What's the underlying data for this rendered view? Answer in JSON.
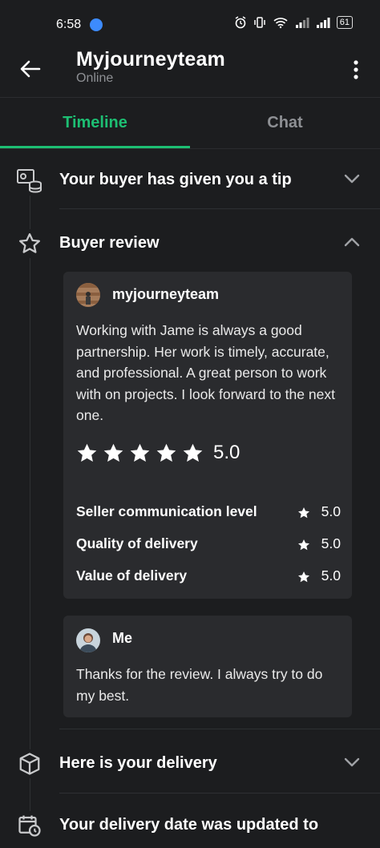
{
  "status": {
    "time": "6:58",
    "battery": "61"
  },
  "header": {
    "title": "Myjourneyteam",
    "subtitle": "Online"
  },
  "tabs": [
    {
      "label": "Timeline",
      "active": true
    },
    {
      "label": "Chat",
      "active": false
    }
  ],
  "timeline": {
    "tip": {
      "title": "Your buyer has given you a tip"
    },
    "review": {
      "title": "Buyer review",
      "reviewer": {
        "name": "myjourneyteam",
        "text": "Working with Jame is always a good partnership. Her work is timely, accurate, and professional. A great person to work with on projects. I look forward to the next one.",
        "rating": "5.0",
        "stars": 5,
        "sub_ratings": [
          {
            "label": "Seller communication level",
            "value": "5.0"
          },
          {
            "label": "Quality of delivery",
            "value": "5.0"
          },
          {
            "label": "Value of delivery",
            "value": "5.0"
          }
        ]
      },
      "reply": {
        "name": "Me",
        "text": "Thanks for the review. I always try to do my best."
      }
    },
    "delivery": {
      "title": "Here is your delivery"
    },
    "date_update": {
      "title": "Your delivery date was updated to"
    }
  },
  "colors": {
    "accent": "#1dbf73",
    "background": "#1c1d1f",
    "card": "#2a2b2e"
  }
}
